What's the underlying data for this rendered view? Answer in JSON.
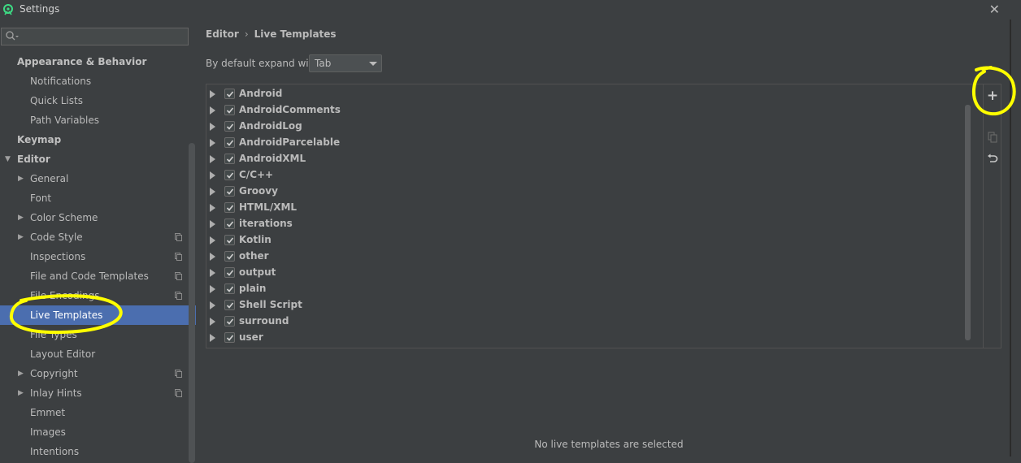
{
  "window": {
    "title": "Settings",
    "close_label": "✕"
  },
  "search": {
    "placeholder": ""
  },
  "sidebar": {
    "items": [
      {
        "label": "Appearance & Behavior",
        "level": 0,
        "bold": true
      },
      {
        "label": "Notifications",
        "level": 1
      },
      {
        "label": "Quick Lists",
        "level": 1
      },
      {
        "label": "Path Variables",
        "level": 1
      },
      {
        "label": "Keymap",
        "level": 0,
        "bold": true
      },
      {
        "label": "Editor",
        "level": 0,
        "bold": true,
        "expanded": true
      },
      {
        "label": "General",
        "level": 1,
        "collapsed": true
      },
      {
        "label": "Font",
        "level": 1
      },
      {
        "label": "Color Scheme",
        "level": 1,
        "collapsed": true
      },
      {
        "label": "Code Style",
        "level": 1,
        "collapsed": true,
        "project_icon": true
      },
      {
        "label": "Inspections",
        "level": 1,
        "project_icon": true
      },
      {
        "label": "File and Code Templates",
        "level": 1,
        "project_icon": true
      },
      {
        "label": "File Encodings",
        "level": 1,
        "project_icon": true
      },
      {
        "label": "Live Templates",
        "level": 1,
        "selected": true
      },
      {
        "label": "File Types",
        "level": 1
      },
      {
        "label": "Layout Editor",
        "level": 1
      },
      {
        "label": "Copyright",
        "level": 1,
        "collapsed": true,
        "project_icon": true
      },
      {
        "label": "Inlay Hints",
        "level": 1,
        "collapsed": true,
        "project_icon": true
      },
      {
        "label": "Emmet",
        "level": 1
      },
      {
        "label": "Images",
        "level": 1
      },
      {
        "label": "Intentions",
        "level": 1
      }
    ]
  },
  "breadcrumb": {
    "parent": "Editor",
    "separator": "›",
    "current": "Live Templates"
  },
  "expand": {
    "label": "By default expand with",
    "value": "Tab"
  },
  "templates": [
    "Android",
    "AndroidComments",
    "AndroidLog",
    "AndroidParcelable",
    "AndroidXML",
    "C/C++",
    "Groovy",
    "HTML/XML",
    "iterations",
    "Kotlin",
    "other",
    "output",
    "plain",
    "Shell Script",
    "surround",
    "user"
  ],
  "toolbar": {
    "add_label": "+"
  },
  "status": {
    "text": "No live templates are selected"
  },
  "colors": {
    "background": "#3c3f41",
    "selection": "#4b6eaf",
    "annotation": "#ffff00"
  }
}
